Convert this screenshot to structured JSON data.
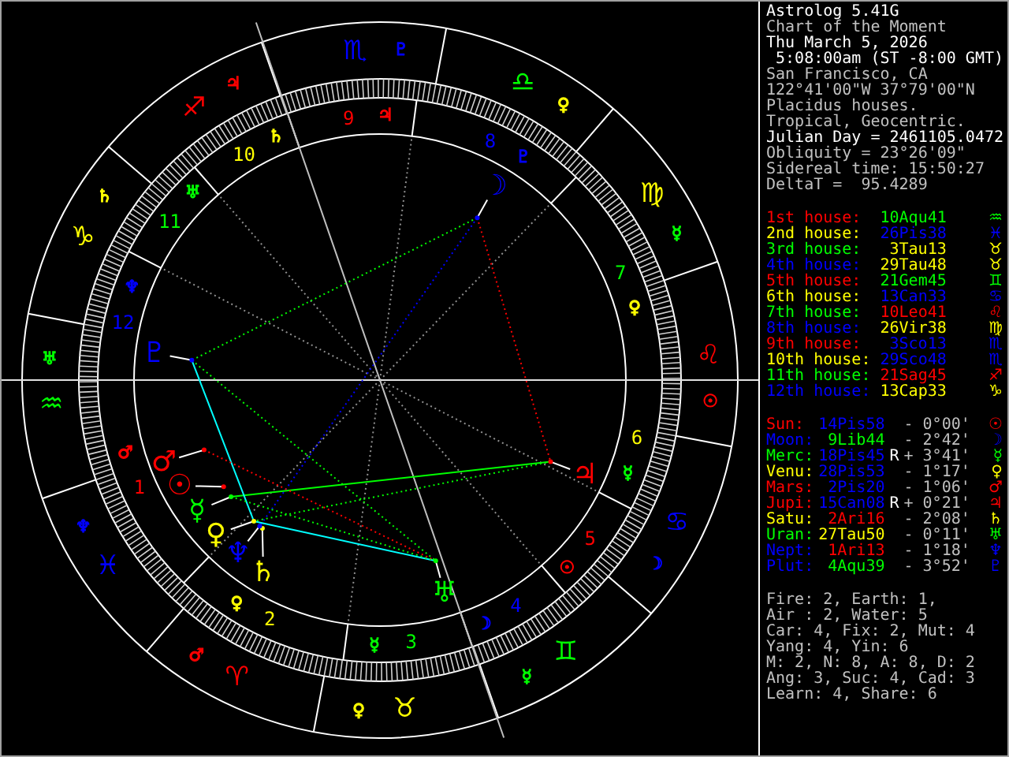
{
  "header": [
    {
      "text": "Astrolog 5.41G",
      "bright": true
    },
    {
      "text": "Chart of the Moment",
      "bright": false
    },
    {
      "text": "Thu March 5, 2026",
      "bright": true
    },
    {
      "text": " 5:08:00am (ST -8:00 GMT)",
      "bright": true
    },
    {
      "text": "San Francisco, CA",
      "bright": false
    },
    {
      "text": "122°41'00\"W 37°79'00\"N",
      "bright": false
    },
    {
      "text": "Placidus houses.",
      "bright": false
    },
    {
      "text": "Tropical, Geocentric.",
      "bright": false
    },
    {
      "text": "Julian Day = 2461105.0472",
      "bright": true
    },
    {
      "text": "Obliquity = 23°26'09\"",
      "bright": false
    },
    {
      "text": "Sidereal time: 15:50:27",
      "bright": false
    },
    {
      "text": "DeltaT =  95.4289",
      "bright": false
    }
  ],
  "houses": [
    {
      "label": "1st house:",
      "color": "#ff0000",
      "position": {
        "text": "10Aqu41",
        "color": "#00ff00"
      },
      "glyph": "♒"
    },
    {
      "label": "2nd house:",
      "color": "#ffff00",
      "position": {
        "text": "26Pis38",
        "color": "#0000ff"
      },
      "glyph": "♓"
    },
    {
      "label": "3rd house:",
      "color": "#00ff00",
      "position": {
        "text": "3Tau13",
        "color": "#ffff00"
      },
      "glyph": "♉"
    },
    {
      "label": "4th house:",
      "color": "#0000ff",
      "position": {
        "text": "29Tau48",
        "color": "#ffff00"
      },
      "glyph": "♉"
    },
    {
      "label": "5th house:",
      "color": "#ff0000",
      "position": {
        "text": "21Gem45",
        "color": "#00ff00"
      },
      "glyph": "♊"
    },
    {
      "label": "6th house:",
      "color": "#ffff00",
      "position": {
        "text": "13Can33",
        "color": "#0000ff"
      },
      "glyph": "♋"
    },
    {
      "label": "7th house:",
      "color": "#00ff00",
      "position": {
        "text": "10Leo41",
        "color": "#ff0000"
      },
      "glyph": "♌"
    },
    {
      "label": "8th house:",
      "color": "#0000ff",
      "position": {
        "text": "26Vir38",
        "color": "#ffff00"
      },
      "glyph": "♍"
    },
    {
      "label": "9th house:",
      "color": "#ff0000",
      "position": {
        "text": "3Sco13",
        "color": "#0000ff"
      },
      "glyph": "♏"
    },
    {
      "label": "10th house:",
      "color": "#ffff00",
      "position": {
        "text": "29Sco48",
        "color": "#0000ff"
      },
      "glyph": "♏"
    },
    {
      "label": "11th house:",
      "color": "#00ff00",
      "position": {
        "text": "21Sag45",
        "color": "#ff0000"
      },
      "glyph": "♐"
    },
    {
      "label": "12th house:",
      "color": "#0000ff",
      "position": {
        "text": "13Cap33",
        "color": "#ffff00"
      },
      "glyph": "♑"
    }
  ],
  "planets": [
    {
      "name": "Sun:",
      "color": "#ff0000",
      "position": {
        "text": "14Pis58",
        "color": "#0000ff"
      },
      "delta": "- 0°00'",
      "glyph": "☉"
    },
    {
      "name": "Moon:",
      "color": "#0000ff",
      "position": {
        "text": "9Lib44",
        "color": "#00ff00"
      },
      "delta": "- 2°42'",
      "glyph": "☽"
    },
    {
      "name": "Merc:",
      "color": "#00ff00",
      "position": {
        "text": "18Pis45",
        "color": "#0000ff"
      },
      "retro": "R",
      "delta": "+ 3°41'",
      "glyph": "☿"
    },
    {
      "name": "Venu:",
      "color": "#ffff00",
      "position": {
        "text": "28Pis53",
        "color": "#0000ff"
      },
      "delta": "- 1°17'",
      "glyph": "♀"
    },
    {
      "name": "Mars:",
      "color": "#ff0000",
      "position": {
        "text": "2Pis20",
        "color": "#0000ff"
      },
      "delta": "- 1°06'",
      "glyph": "♂"
    },
    {
      "name": "Jupi:",
      "color": "#ff0000",
      "position": {
        "text": "15Can08",
        "color": "#0000ff"
      },
      "retro": "R",
      "delta": "+ 0°21'",
      "glyph": "♃"
    },
    {
      "name": "Satu:",
      "color": "#ffff00",
      "position": {
        "text": "2Ari16",
        "color": "#ff0000"
      },
      "delta": "- 2°08'",
      "glyph": "♄"
    },
    {
      "name": "Uran:",
      "color": "#00ff00",
      "position": {
        "text": "27Tau50",
        "color": "#ffff00"
      },
      "delta": "- 0°11'",
      "glyph": "♅"
    },
    {
      "name": "Nept:",
      "color": "#0000ff",
      "position": {
        "text": "1Ari13",
        "color": "#ff0000"
      },
      "delta": "- 1°18'",
      "glyph": "♆"
    },
    {
      "name": "Plut:",
      "color": "#0000ff",
      "position": {
        "text": "4Aqu39",
        "color": "#00ff00"
      },
      "delta": "- 3°52'",
      "glyph": "♇"
    }
  ],
  "stats": [
    "Fire: 2, Earth: 1,",
    "Air : 2, Water: 5",
    "Car: 4, Fix: 2, Mut: 4",
    "Yang: 4, Yin: 6",
    "M: 2, N: 8, A: 8, D: 2",
    "Ang: 3, Suc: 4, Cad: 3",
    "Learn: 4, Share: 6"
  ],
  "wheel": {
    "signs": [
      {
        "glyph": "♈",
        "color": "#ff0000",
        "ruler": {
          "glyph": "♂",
          "color": "#ff0000"
        }
      },
      {
        "glyph": "♉",
        "color": "#ffff00",
        "ruler": {
          "glyph": "♀",
          "color": "#ffff00"
        }
      },
      {
        "glyph": "♊",
        "color": "#00ff00",
        "ruler": {
          "glyph": "☿",
          "color": "#00ff00"
        }
      },
      {
        "glyph": "♋",
        "color": "#0000ff",
        "ruler": {
          "glyph": "☽",
          "color": "#0000ff"
        }
      },
      {
        "glyph": "♌",
        "color": "#ff0000",
        "ruler": {
          "glyph": "☉",
          "color": "#ff0000"
        }
      },
      {
        "glyph": "♍",
        "color": "#ffff00",
        "ruler": {
          "glyph": "☿",
          "color": "#00ff00"
        }
      },
      {
        "glyph": "♎",
        "color": "#00ff00",
        "ruler": {
          "glyph": "♀",
          "color": "#ffff00"
        }
      },
      {
        "glyph": "♏",
        "color": "#0000ff",
        "ruler": {
          "glyph": "♇",
          "color": "#0000ff"
        }
      },
      {
        "glyph": "♐",
        "color": "#ff0000",
        "ruler": {
          "glyph": "♃",
          "color": "#ff0000"
        }
      },
      {
        "glyph": "♑",
        "color": "#ffff00",
        "ruler": {
          "glyph": "♄",
          "color": "#ffff00"
        }
      },
      {
        "glyph": "♒",
        "color": "#00ff00",
        "ruler": {
          "glyph": "♅",
          "color": "#00ff00"
        }
      },
      {
        "glyph": "♓",
        "color": "#0000ff",
        "ruler": {
          "glyph": "♆",
          "color": "#0000ff"
        }
      }
    ],
    "houses": [
      {
        "number": "1",
        "color": "#ff0000",
        "ruler": {
          "glyph": "♂",
          "color": "#ff0000"
        }
      },
      {
        "number": "2",
        "color": "#ffff00",
        "ruler": {
          "glyph": "♀",
          "color": "#ffff00"
        }
      },
      {
        "number": "3",
        "color": "#00ff00",
        "ruler": {
          "glyph": "☿",
          "color": "#00ff00"
        }
      },
      {
        "number": "4",
        "color": "#0000ff",
        "ruler": {
          "glyph": "☽",
          "color": "#0000ff"
        }
      },
      {
        "number": "5",
        "color": "#ff0000",
        "ruler": {
          "glyph": "☉",
          "color": "#ff0000"
        }
      },
      {
        "number": "6",
        "color": "#ffff00",
        "ruler": {
          "glyph": "☿",
          "color": "#00ff00"
        }
      },
      {
        "number": "7",
        "color": "#00ff00",
        "ruler": {
          "glyph": "♀",
          "color": "#ffff00"
        }
      },
      {
        "number": "8",
        "color": "#0000ff",
        "ruler": {
          "glyph": "♇",
          "color": "#0000ff"
        }
      },
      {
        "number": "9",
        "color": "#ff0000",
        "ruler": {
          "glyph": "♃",
          "color": "#ff0000"
        }
      },
      {
        "number": "10",
        "color": "#ffff00",
        "ruler": {
          "glyph": "♄",
          "color": "#ffff00"
        }
      },
      {
        "number": "11",
        "color": "#00ff00",
        "ruler": {
          "glyph": "♅",
          "color": "#00ff00"
        }
      },
      {
        "number": "12",
        "color": "#0000ff",
        "ruler": {
          "glyph": "♆",
          "color": "#0000ff"
        }
      }
    ],
    "planets": [
      {
        "glyph": "☉",
        "color": "#ff0000"
      },
      {
        "glyph": "☽",
        "color": "#0000ff"
      },
      {
        "glyph": "☿",
        "color": "#00ff00"
      },
      {
        "glyph": "♀",
        "color": "#ffff00"
      },
      {
        "glyph": "♂",
        "color": "#ff0000"
      },
      {
        "glyph": "♃",
        "color": "#ff0000"
      },
      {
        "glyph": "♄",
        "color": "#ffff00"
      },
      {
        "glyph": "♅",
        "color": "#00ff00"
      },
      {
        "glyph": "♆",
        "color": "#0000ff"
      },
      {
        "glyph": "♇",
        "color": "#0000ff"
      }
    ]
  }
}
